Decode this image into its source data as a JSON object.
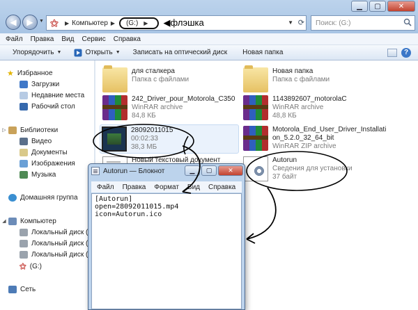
{
  "explorer": {
    "address": {
      "computer": "Компьютер",
      "drive": "(G:)",
      "note": "флэшка"
    },
    "search_placeholder": "Поиск: (G:)",
    "menu": [
      "Файл",
      "Правка",
      "Вид",
      "Сервис",
      "Справка"
    ],
    "toolbar": {
      "organize": "Упорядочить",
      "open": "Открыть",
      "burn": "Записать на оптический диск",
      "new_folder": "Новая папка"
    }
  },
  "navpane": {
    "favorites": "Избранное",
    "favorites_items": [
      "Загрузки",
      "Недавние места",
      "Рабочий стол"
    ],
    "libraries": "Библиотеки",
    "libraries_items": [
      "Видео",
      "Документы",
      "Изображения",
      "Музыка"
    ],
    "homegroup": "Домашняя группа",
    "computer": "Компьютер",
    "computer_items": [
      "Локальный диск (C:)",
      "Локальный диск (D:)",
      "Локальный диск (E:)",
      "(G:)"
    ],
    "network": "Сеть"
  },
  "files": [
    {
      "name": "для сталкера",
      "sub1": "Папка с файлами",
      "sub2": "",
      "icon": "folder-icon"
    },
    {
      "name": "Новая папка",
      "sub1": "Папка с файлами",
      "sub2": "",
      "icon": "folder-icon"
    },
    {
      "name": "242_Driver_pour_Motorola_C350",
      "sub1": "WinRAR archive",
      "sub2": "84,8 КБ",
      "icon": "winrar-icon"
    },
    {
      "name": "1143892607_motorolaC",
      "sub1": "WinRAR archive",
      "sub2": "48,8 КБ",
      "icon": "winrar-icon"
    },
    {
      "name": "28092011015",
      "sub1": "00:02:33",
      "sub2": "38,3 МБ",
      "icon": "video-icon"
    },
    {
      "name": "Motorola_End_User_Driver_Installati",
      "sub1": "on_5.2.0_32_64_bit",
      "sub2": "WinRAR ZIP archive",
      "icon": "winrar-icon"
    },
    {
      "name": "Новый текстовый документ",
      "sub1": "",
      "sub2": "",
      "icon": "text-document-icon"
    },
    {
      "name": "Autorun",
      "sub1": "Сведения для установки",
      "sub2": "37 байт",
      "icon": "setup-info-icon"
    }
  ],
  "notepad": {
    "title": "Autorun — Блокнот",
    "menu": [
      "Файл",
      "Правка",
      "Формат",
      "Вид",
      "Справка"
    ],
    "lines": [
      "[Autorun]",
      "open=28092011015.mp4",
      "icon=Autorun.ico"
    ]
  },
  "colors": {
    "titlebar": "#bcd3ec",
    "close": "#c2432f",
    "selection": "#eaf2fc",
    "annotation": "#000000"
  }
}
